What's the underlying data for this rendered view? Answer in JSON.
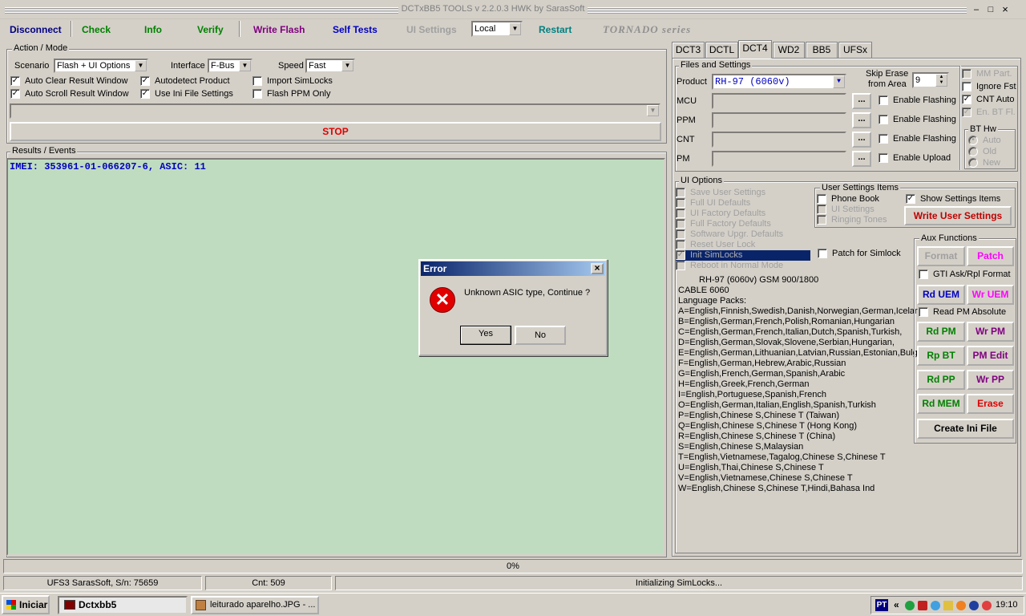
{
  "window": {
    "title": "DCTxBB5 TOOLS v 2.2.0.3 HWK by SarasSoft",
    "controls": [
      "–",
      "□",
      "×"
    ]
  },
  "toolbar": {
    "disconnect": "Disconnect",
    "check": "Check",
    "info": "Info",
    "verify": "Verify",
    "write_flash": "Write Flash",
    "self_tests": "Self Tests",
    "ui_settings": "UI Settings",
    "mode_value": "Local",
    "restart": "Restart",
    "series": "TORNADO series"
  },
  "colors": {
    "green": "#008000",
    "purple": "#800080",
    "blue": "#0000c0",
    "teal": "#008080",
    "magenta": "#ff00ff",
    "red": "#c00000",
    "navy": "#000080",
    "results_bg": "#c0dcc0"
  },
  "action": {
    "legend": "Action / Mode",
    "scenario_label": "Scenario",
    "scenario_value": "Flash + UI Options",
    "interface_label": "Interface",
    "interface_value": "F-Bus",
    "speed_label": "Speed",
    "speed_value": "Fast",
    "checks": [
      {
        "label": "Auto Clear Result Window",
        "checked": true
      },
      {
        "label": "Autodetect Product",
        "checked": true
      },
      {
        "label": "Import SimLocks",
        "checked": false
      },
      {
        "label": "Auto Scroll Result Window",
        "checked": true
      },
      {
        "label": "Use Ini File Settings",
        "checked": true
      },
      {
        "label": "Flash PPM Only",
        "checked": false
      }
    ],
    "stop": "STOP"
  },
  "results": {
    "legend": "Results / Events",
    "line": "IMEI: 353961-01-066207-6, ASIC: 11"
  },
  "tabs": [
    "DCT3",
    "DCTL",
    "DCT4",
    "WD2",
    "BB5",
    "UFSx"
  ],
  "files": {
    "legend": "Files and Settings",
    "product_label": "Product",
    "product_value": "RH-97  (6060v)",
    "skip_erase": "Skip Erase",
    "from_area": "from Area",
    "skip_value": "9",
    "rows": [
      {
        "label": "MCU",
        "check": "Enable Flashing"
      },
      {
        "label": "PPM",
        "check": "Enable Flashing"
      },
      {
        "label": "CNT",
        "check": "Enable Flashing"
      },
      {
        "label": "PM",
        "check": "Enable Upload"
      }
    ],
    "browse": "...",
    "right_checks": [
      {
        "label": "MM Part.",
        "checked": false,
        "disabled": true
      },
      {
        "label": "Ignore Fst",
        "checked": false,
        "disabled": false
      },
      {
        "label": "CNT Auto",
        "checked": true,
        "disabled": false
      },
      {
        "label": "En. BT Fl.",
        "checked": true,
        "disabled": true
      }
    ],
    "bthw": {
      "legend": "BT Hw",
      "options": [
        "Auto",
        "Old",
        "New"
      ]
    }
  },
  "ui_options": {
    "legend": "UI Options",
    "items": [
      "Save User Settings",
      "Full UI Defaults",
      "UI Factory Defaults",
      "Full Factory Defaults",
      "Software Upgr. Defaults",
      "Reset User Lock",
      "Init SimLocks",
      "Reboot in Normal Mode"
    ],
    "patch": "Patch for Simlock",
    "user_settings": {
      "legend": "User Settings Items",
      "items": [
        {
          "label": "Phone Book",
          "disabled": false
        },
        {
          "label": "UI Settings",
          "disabled": true
        },
        {
          "label": "Ringing Tones",
          "disabled": true
        }
      ],
      "show": "Show Settings Items",
      "write": "Write User Settings"
    }
  },
  "info_lines": [
    "RH-97 (6060v) GSM 900/1800",
    "CABLE 6060",
    "Language Packs:",
    "A=English,Finnish,Swedish,Danish,Norwegian,German,Icelar",
    "B=English,German,French,Polish,Romanian,Hungarian",
    "C=English,German,French,Italian,Dutch,Spanish,Turkish,",
    "D=English,German,Slovak,Slovene,Serbian,Hungarian,",
    "E=English,German,Lithuanian,Latvian,Russian,Estonian,Bulg",
    "F=English,German,Hebrew,Arabic,Russian",
    "G=English,French,German,Spanish,Arabic",
    "H=English,Greek,French,German",
    "I=English,Portuguese,Spanish,French",
    "O=English,German,Italian,English,Spanish,Turkish",
    "P=English,Chinese S,Chinese T (Taiwan)",
    "Q=English,Chinese S,Chinese T (Hong Kong)",
    "R=English,Chinese S,Chinese T (China)",
    "S=English,Chinese S,Malaysian",
    "T=English,Vietnamese,Tagalog,Chinese S,Chinese T",
    "U=English,Thai,Chinese S,Chinese T",
    "V=English,Vietnamese,Chinese S,Chinese T",
    "W=English,Chinese S,Chinese T,Hindi,Bahasa Ind"
  ],
  "aux": {
    "legend": "Aux Functions",
    "format": "Format",
    "patch": "Patch",
    "gti": "GTI Ask/Rpl Format",
    "rd_uem": "Rd UEM",
    "wr_uem": "Wr UEM",
    "read_pm": "Read PM Absolute",
    "rd_pm": "Rd PM",
    "wr_pm": "Wr PM",
    "rp_bt": "Rp BT",
    "pm_edit": "PM Edit",
    "rd_pp": "Rd PP",
    "wr_pp": "Wr PP",
    "rd_mem": "Rd MEM",
    "erase": "Erase",
    "create_ini": "Create Ini File"
  },
  "progress": {
    "text": "0%",
    "value": 0
  },
  "status": {
    "serial": "UFS3 SarasSoft, S/n: 75659",
    "cnt": "Cnt: 509",
    "message": "Initializing SimLocks..."
  },
  "dialog": {
    "title": "Error",
    "message": "Unknown ASIC type, Continue ?",
    "yes": "Yes",
    "no": "No",
    "close": "×"
  },
  "taskbar": {
    "start": "Iniciar",
    "tasks": [
      "Dctxbb5",
      "leiturado aparelho.JPG - ..."
    ],
    "lang": "PT",
    "chevron": "«",
    "clock": "19:10"
  }
}
